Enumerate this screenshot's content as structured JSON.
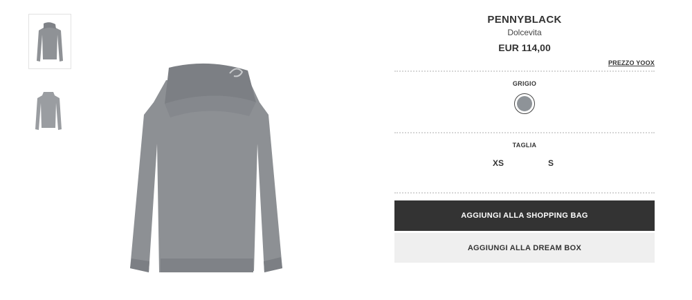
{
  "product": {
    "brand": "PENNYBLACK",
    "category": "Dolcevita",
    "price": "EUR 114,00",
    "price_link": "PREZZO YOOX"
  },
  "color": {
    "label": "GRIGIO",
    "swatch_color": "#8e9398"
  },
  "size": {
    "label": "TAGLIA",
    "options": [
      "XS",
      "S"
    ]
  },
  "actions": {
    "add_to_bag": "AGGIUNGI ALLA SHOPPING BAG",
    "add_to_dreambox": "AGGIUNGI ALLA DREAM BOX"
  },
  "thumbnails": [
    "front-view",
    "back-view"
  ]
}
